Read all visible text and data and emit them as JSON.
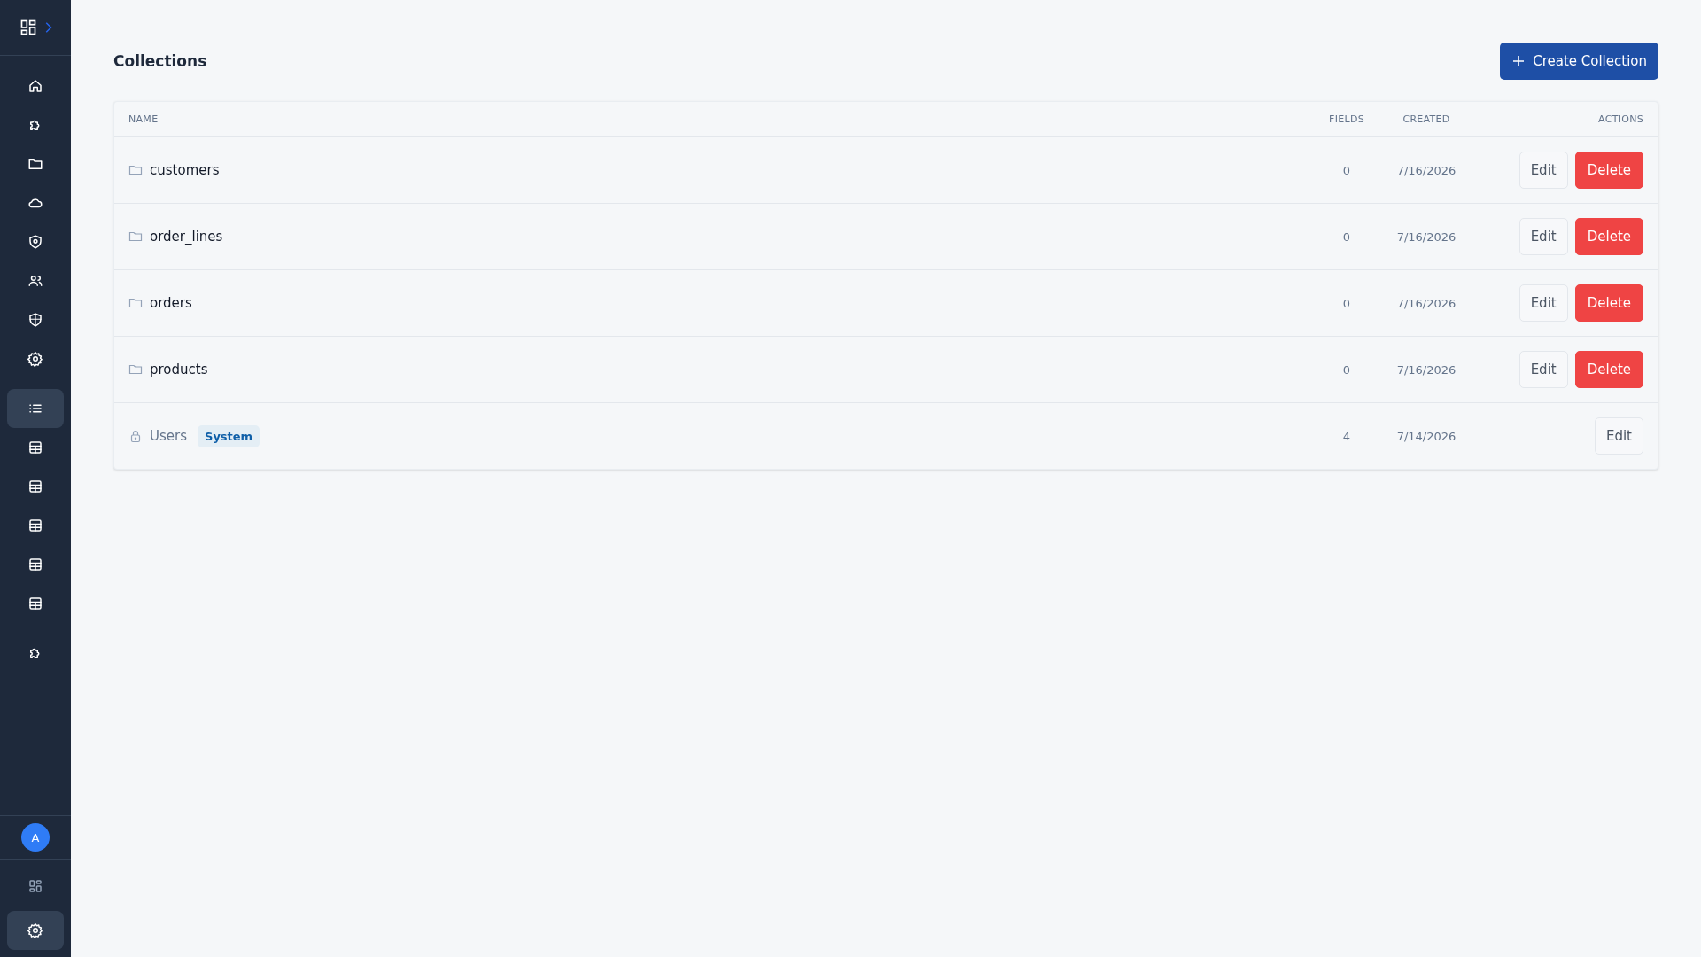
{
  "sidebar": {
    "nav": [
      {
        "kind": "home",
        "selected": false
      },
      {
        "kind": "puzzle",
        "selected": false
      },
      {
        "kind": "folder",
        "selected": false
      },
      {
        "kind": "cloud",
        "selected": false
      },
      {
        "kind": "shield-at",
        "selected": false
      },
      {
        "kind": "users",
        "selected": false
      },
      {
        "kind": "shield",
        "selected": false
      },
      {
        "kind": "gear",
        "selected": false
      }
    ],
    "collections": [
      {
        "kind": "list",
        "selected": true
      },
      {
        "kind": "table",
        "selected": false
      },
      {
        "kind": "table",
        "selected": false
      },
      {
        "kind": "table",
        "selected": false
      },
      {
        "kind": "table",
        "selected": false
      },
      {
        "kind": "table",
        "selected": false
      }
    ],
    "plugins": [
      {
        "kind": "puzzle",
        "selected": false
      }
    ],
    "avatar": "A",
    "bottom": [
      {
        "kind": "grid",
        "selected": false
      },
      {
        "kind": "gear",
        "selected": true
      }
    ]
  },
  "page": {
    "title": "Collections",
    "create_button": "Create Collection"
  },
  "table": {
    "columns": [
      "NAME",
      "FIELDS",
      "CREATED",
      "ACTIONS"
    ],
    "rows": [
      {
        "kind": "collection",
        "name": "customers",
        "fields": "0",
        "created": "7/16/2026",
        "actions": [
          {
            "label": "Edit",
            "kind": "secondary"
          },
          {
            "label": "Delete",
            "kind": "danger"
          }
        ]
      },
      {
        "kind": "collection",
        "name": "order_lines",
        "fields": "0",
        "created": "7/16/2026",
        "actions": [
          {
            "label": "Edit",
            "kind": "secondary"
          },
          {
            "label": "Delete",
            "kind": "danger"
          }
        ]
      },
      {
        "kind": "collection",
        "name": "orders",
        "fields": "0",
        "created": "7/16/2026",
        "actions": [
          {
            "label": "Edit",
            "kind": "secondary"
          },
          {
            "label": "Delete",
            "kind": "danger"
          }
        ]
      },
      {
        "kind": "collection",
        "name": "products",
        "fields": "0",
        "created": "7/16/2026",
        "actions": [
          {
            "label": "Edit",
            "kind": "secondary"
          },
          {
            "label": "Delete",
            "kind": "danger"
          }
        ]
      },
      {
        "kind": "system",
        "name": "Users",
        "badge": "System",
        "fields": "4",
        "created": "7/14/2026",
        "actions": [
          {
            "label": "Edit",
            "kind": "secondary"
          }
        ]
      }
    ]
  }
}
